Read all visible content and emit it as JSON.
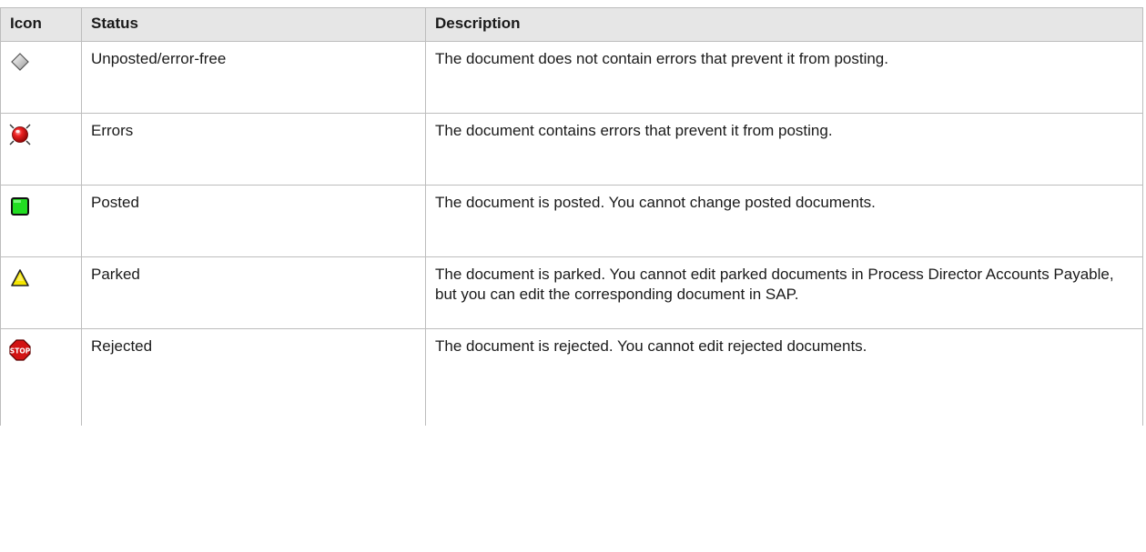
{
  "table": {
    "headers": {
      "icon": "Icon",
      "status": "Status",
      "description": "Description"
    },
    "rows": [
      {
        "icon": "gray-diamond-icon",
        "status": "Unposted/error-free",
        "description": "The document does not contain errors that prevent it from posting."
      },
      {
        "icon": "red-sphere-error-icon",
        "status": "Errors",
        "description": "The document contains errors that prevent it from posting."
      },
      {
        "icon": "green-square-icon",
        "status": "Posted",
        "description": "The document is posted. You cannot change posted documents."
      },
      {
        "icon": "yellow-triangle-icon",
        "status": "Parked",
        "description": "The document is parked. You cannot edit parked documents in Process Director Accounts Payable, but you can edit the corresponding document in SAP."
      },
      {
        "icon": "red-stop-sign-icon",
        "status": "Rejected",
        "description": "The document is rejected. You cannot edit rejected documents."
      }
    ]
  },
  "colors": {
    "header_bg": "#e6e6e6",
    "border": "#bdbdbd",
    "error_red": "#e11a1a",
    "posted_green": "#2bd62b",
    "parked_yellow": "#f2e400",
    "stop_red": "#d11414"
  },
  "stop_sign_text": "STOP"
}
